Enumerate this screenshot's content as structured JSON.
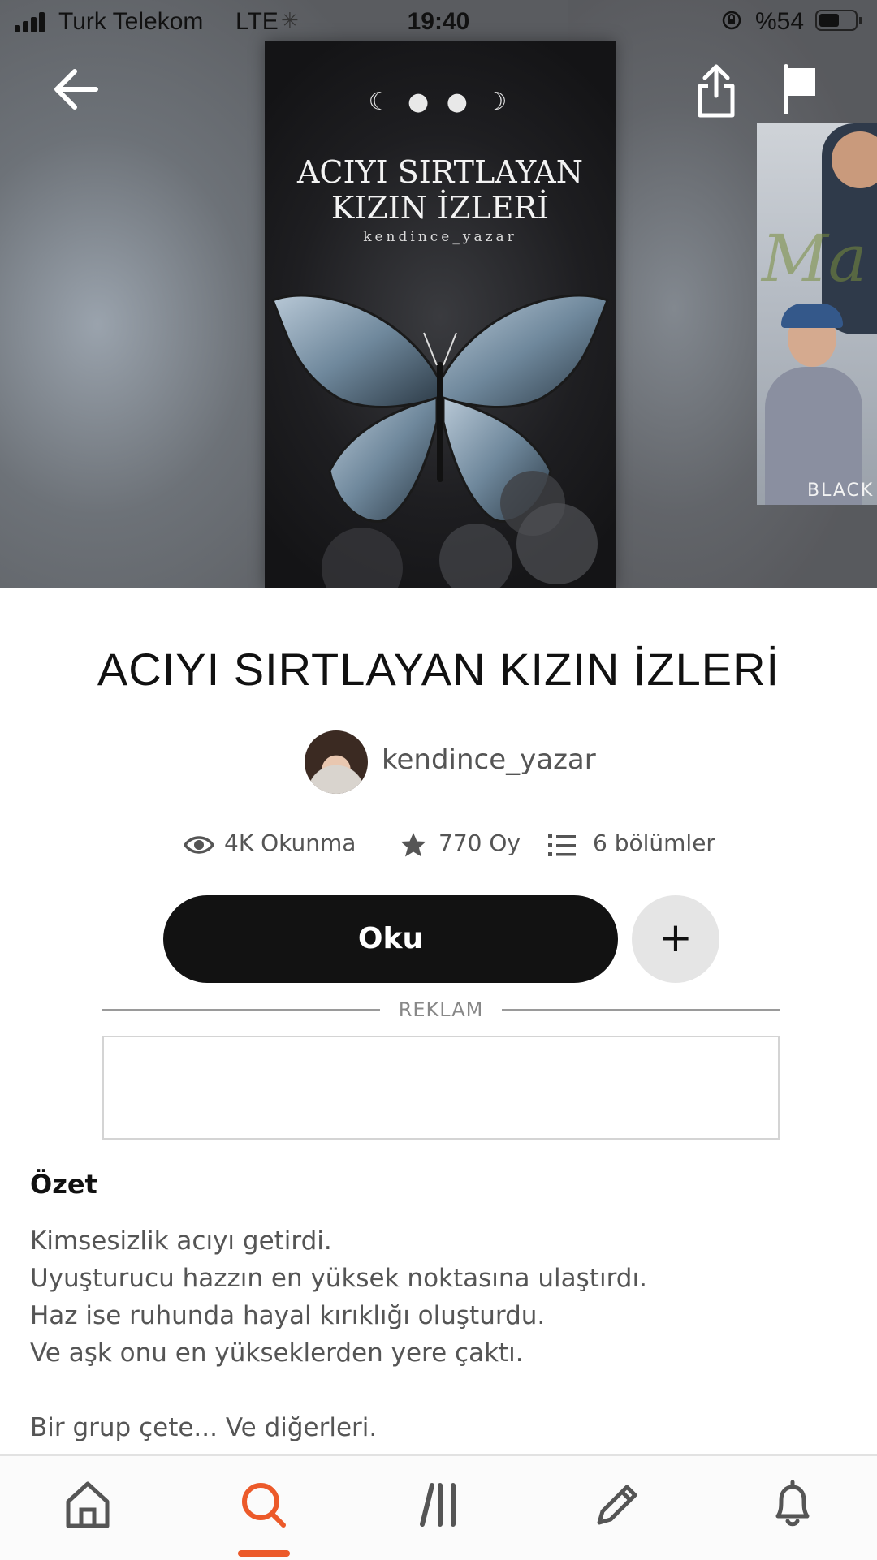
{
  "status_bar": {
    "carrier": "Turk Telekom",
    "network": "LTE",
    "time": "19:40",
    "battery_percent": "%54"
  },
  "header": {
    "back_icon": "arrow-left-icon",
    "share_icon": "share-icon",
    "report_icon": "flag-icon",
    "cover": {
      "title_line1": "ACIYI SIRTLAYAN",
      "title_line2": "KIZIN İZLERİ",
      "author": "kendince_yazar"
    },
    "next_cover_text": "BLACK"
  },
  "book": {
    "title": "ACIYI SIRTLAYAN KIZIN İZLERİ",
    "author": "kendince_yazar",
    "stats": {
      "reads": "4K Okunma",
      "votes": "770 Oy",
      "parts": "6 bölümler"
    },
    "read_button": "Oku",
    "add_button_icon": "plus-icon"
  },
  "ad": {
    "label": "REKLAM"
  },
  "summary": {
    "heading": "Özet",
    "lines": [
      "Kimsesizlik acıyı getirdi.",
      "Uyuşturucu hazzın en yüksek noktasına ulaştırdı.",
      "Haz ise ruhunda hayal kırıklığı oluşturdu.",
      "Ve aşk onu en yükseklerden yere çaktı.",
      "",
      "Bir grup çete... Ve diğerleri."
    ]
  },
  "bottom_nav": {
    "items": [
      {
        "icon": "home-icon"
      },
      {
        "icon": "search-icon",
        "active": true
      },
      {
        "icon": "library-icon"
      },
      {
        "icon": "write-icon"
      },
      {
        "icon": "bell-icon"
      }
    ],
    "accent_color": "#ec5a2a"
  }
}
